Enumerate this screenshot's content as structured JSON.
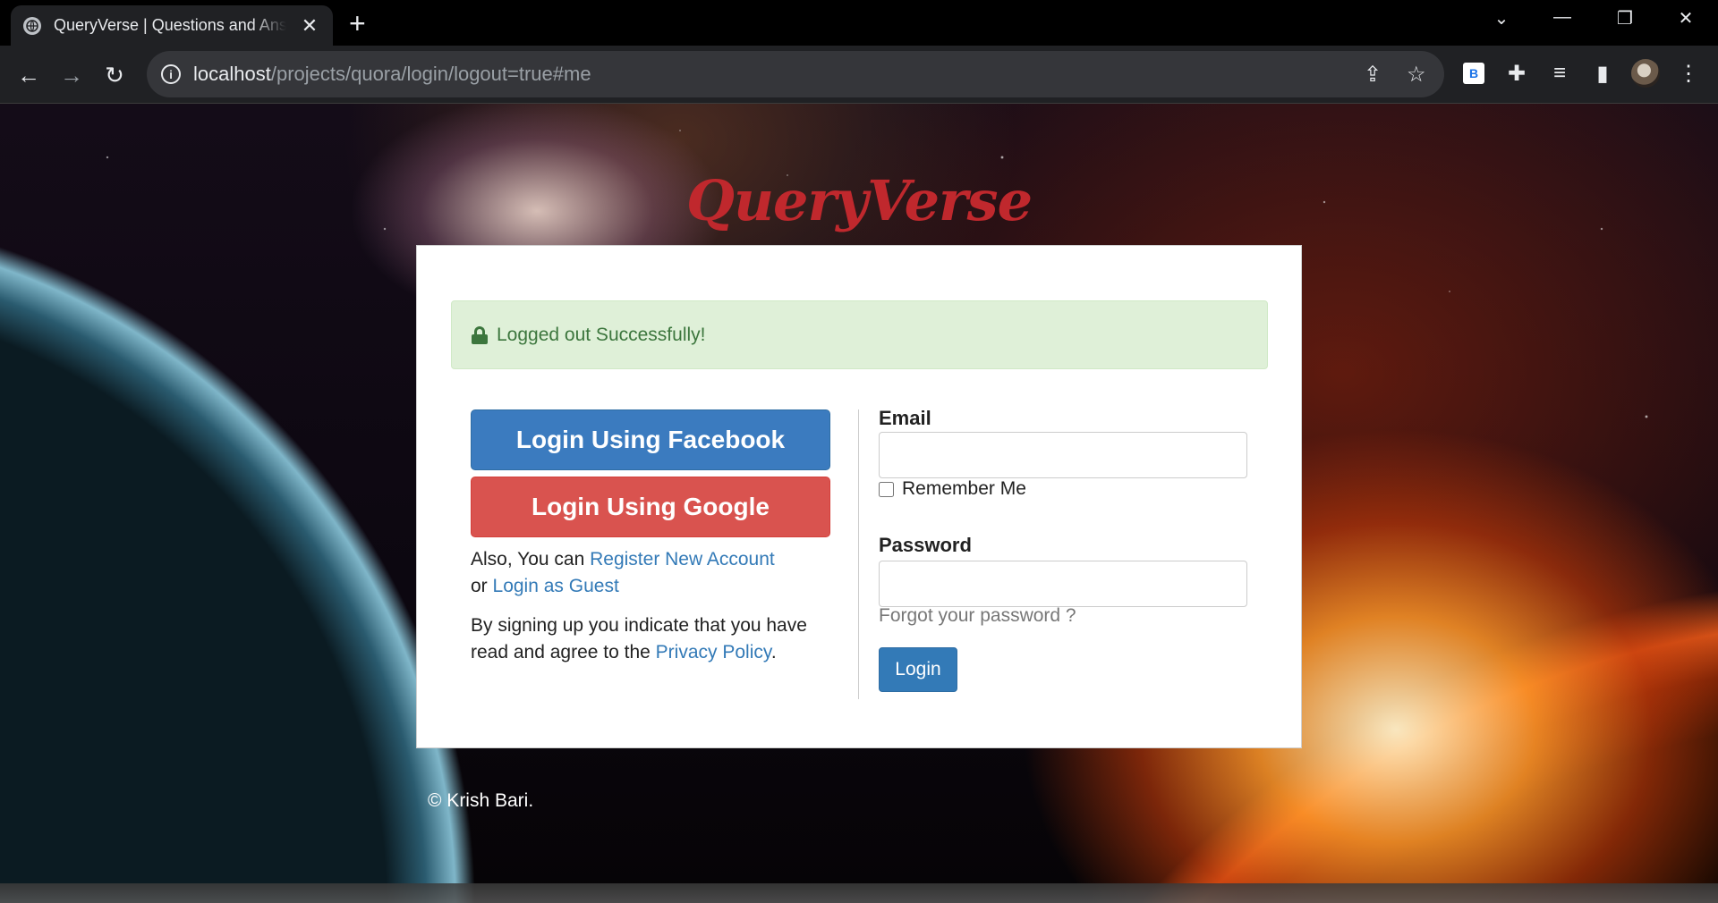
{
  "browser": {
    "tab_title": "QueryVerse | Questions and Answers",
    "tab_close": "✕",
    "new_tab": "+",
    "url_host": "localhost",
    "url_path": "/projects/quora/login/logout=true#me",
    "extension_b_label": "B"
  },
  "site": {
    "logo": "QueryVerse"
  },
  "alert": {
    "message": "Logged out Successfully!"
  },
  "social": {
    "facebook_label": "Login Using Facebook",
    "google_label": "Login Using Google"
  },
  "left_text": {
    "also_prefix": "Also, You can ",
    "register_link": "Register New Account",
    "or_prefix": "or ",
    "guest_link": "Login as Guest",
    "policy_prefix": "By signing up you indicate that you have read and agree to the ",
    "policy_link": "Privacy Policy",
    "policy_suffix": "."
  },
  "form": {
    "email_label": "Email",
    "email_value": "",
    "remember_label": "Remember Me",
    "remember_checked": false,
    "password_label": "Password",
    "password_value": "",
    "forgot_link": "Forgot your password ?",
    "login_button": "Login"
  },
  "footer": {
    "copyright": "© Krish Bari."
  },
  "colors": {
    "logo": "#c0282d",
    "facebook": "#3b7bbf",
    "google": "#d9534f",
    "alert_bg": "#dff0d8",
    "alert_text": "#3c763d",
    "link": "#337ab7",
    "primary_button": "#337ab7"
  }
}
